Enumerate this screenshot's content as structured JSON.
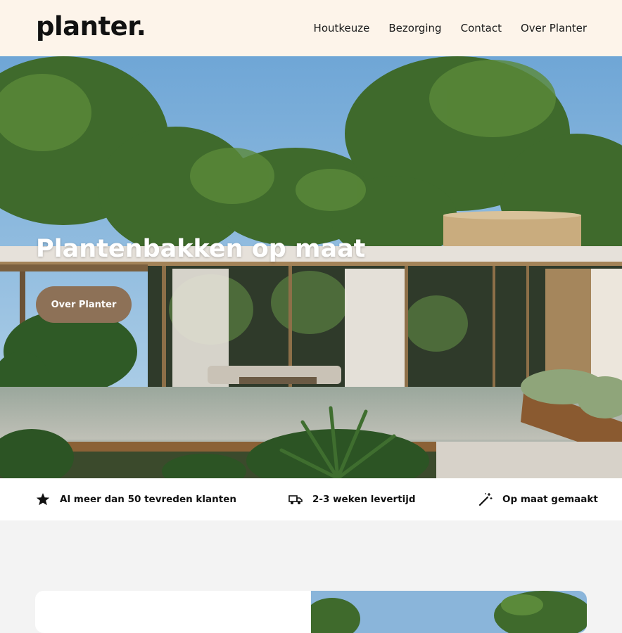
{
  "header": {
    "logo": "planter.",
    "nav": [
      "Houtkeuze",
      "Bezorging",
      "Contact",
      "Over Planter"
    ]
  },
  "hero": {
    "title": "Plantenbakken op maat",
    "button_label": "Over Planter"
  },
  "usp": [
    {
      "icon": "star-icon",
      "label": "Al meer dan 50 tevreden klanten"
    },
    {
      "icon": "delivery-truck-icon",
      "label": "2-3 weken levertijd"
    },
    {
      "icon": "magic-wand-icon",
      "label": "Op maat gemaakt"
    }
  ],
  "colors": {
    "header_bg": "#fdf4ea",
    "accent_button": "#8d7157",
    "section_bg": "#f3f3f3"
  }
}
